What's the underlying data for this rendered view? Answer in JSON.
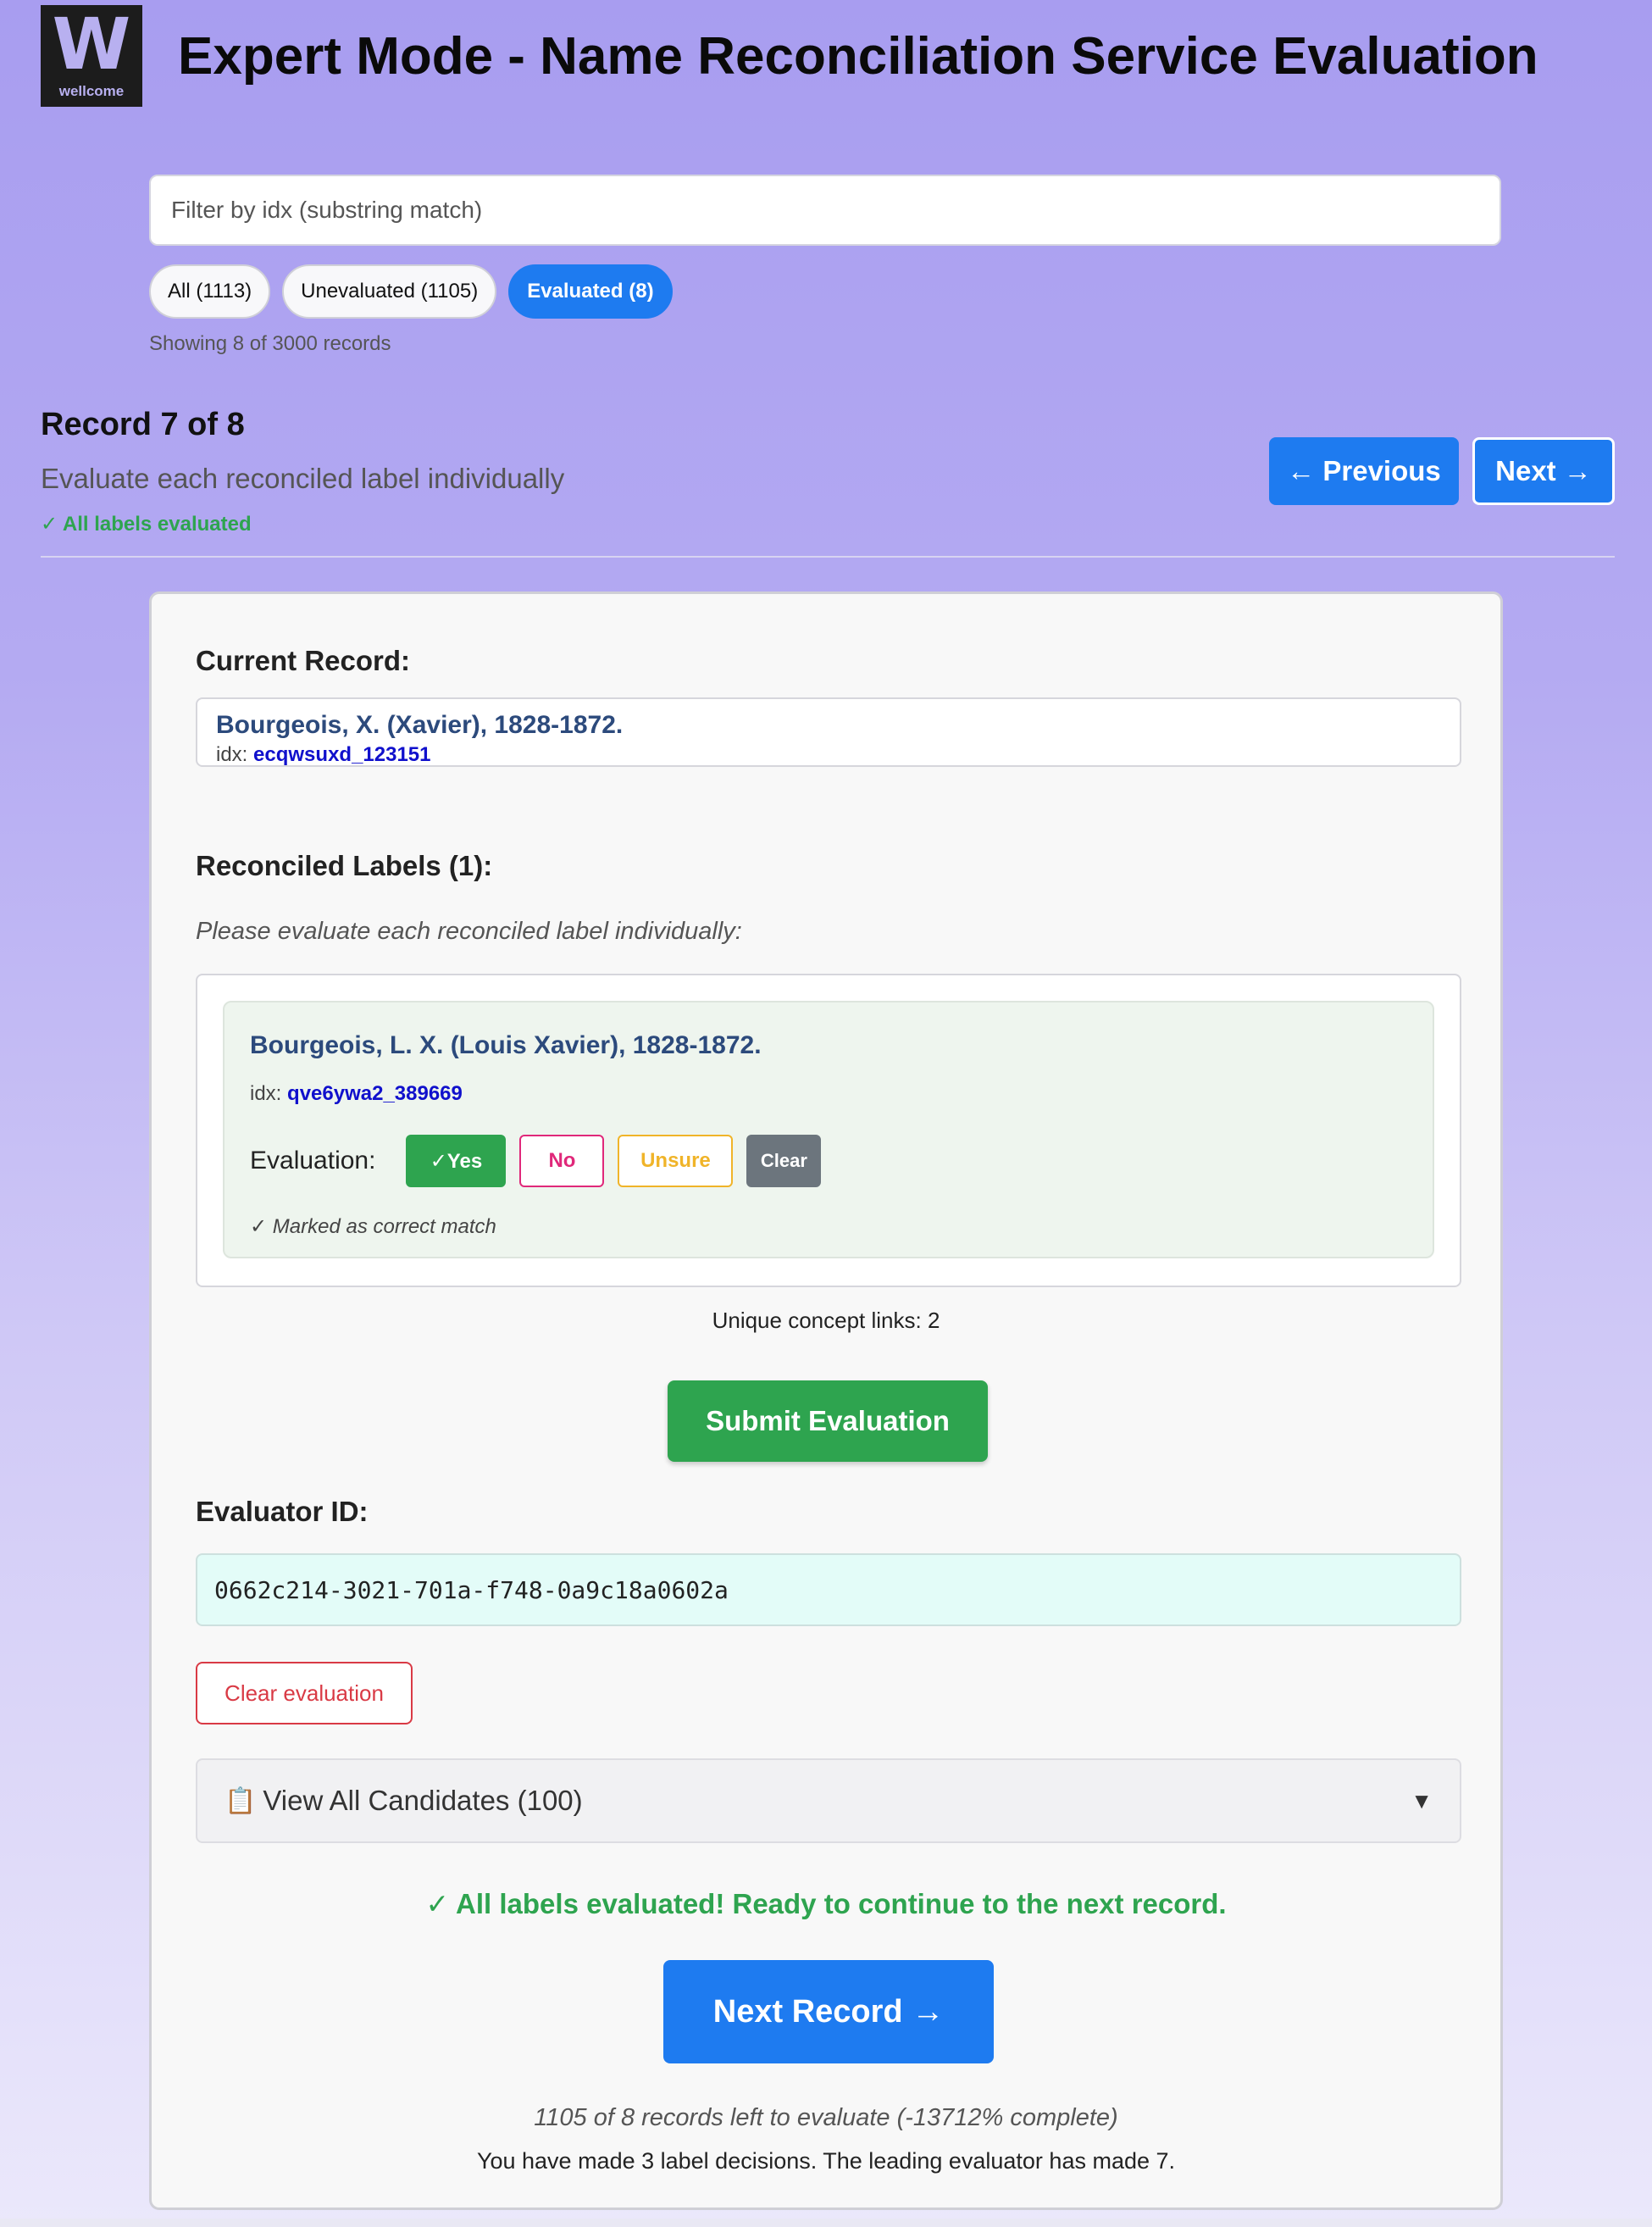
{
  "header": {
    "logo_letter": "W",
    "logo_text": "wellcome",
    "title": "Expert Mode - Name Reconciliation Service Evaluation"
  },
  "filter": {
    "placeholder": "Filter by idx (substring match)",
    "value": ""
  },
  "filter_tabs": [
    {
      "label": "All (1113)",
      "active": false
    },
    {
      "label": "Unevaluated (1105)",
      "active": false
    },
    {
      "label": "Evaluated (8)",
      "active": true
    }
  ],
  "showing_text": "Showing 8 of 3000 records",
  "record_nav": {
    "title": "Record 7 of 8",
    "subtitle": "Evaluate each reconciled label individually",
    "status": "✓ All labels evaluated",
    "prev_label": "← Previous",
    "next_label": "Next →"
  },
  "current_record": {
    "heading": "Current Record:",
    "name": "Bourgeois, X. (Xavier), 1828-1872.",
    "idx_label": "idx:",
    "idx_value": "ecqwsuxd_123151"
  },
  "reconciled": {
    "heading": "Reconciled Labels (1):",
    "note": "Please evaluate each reconciled label individually:",
    "labels": [
      {
        "name": "Bourgeois, L. X. (Louis Xavier), 1828-1872.",
        "idx_label": "idx:",
        "idx_value": "qve6ywa2_389669",
        "evaluation_label": "Evaluation:",
        "buttons": {
          "yes": "✓Yes",
          "no": "No",
          "unsure": "Unsure",
          "clear": "Clear"
        },
        "selected": "yes",
        "marked_text": "✓ Marked as correct match"
      }
    ]
  },
  "unique_links": "Unique concept links: 2",
  "submit_label": "Submit Evaluation",
  "evaluator": {
    "heading": "Evaluator ID:",
    "value": "0662c214-3021-701a-f748-0a9c18a0602a"
  },
  "clear_evaluation_label": "Clear evaluation",
  "candidates": {
    "icon": "clipboard-icon",
    "label": "View All Candidates (100)",
    "arrow": "▼"
  },
  "all_done_text": "✓ All labels evaluated! Ready to continue to the next record.",
  "next_record_label": "Next Record →",
  "progress_text": "1105 of 8 records left to evaluate (-13712% complete)",
  "decisions_text": "You have made 3 label decisions. The leading evaluator has made 7.",
  "colors": {
    "accent_blue": "#1e7bf0",
    "success_green": "#2ea44f",
    "danger_red": "#d93a45",
    "pink": "#e0287a",
    "amber": "#f0b429"
  }
}
